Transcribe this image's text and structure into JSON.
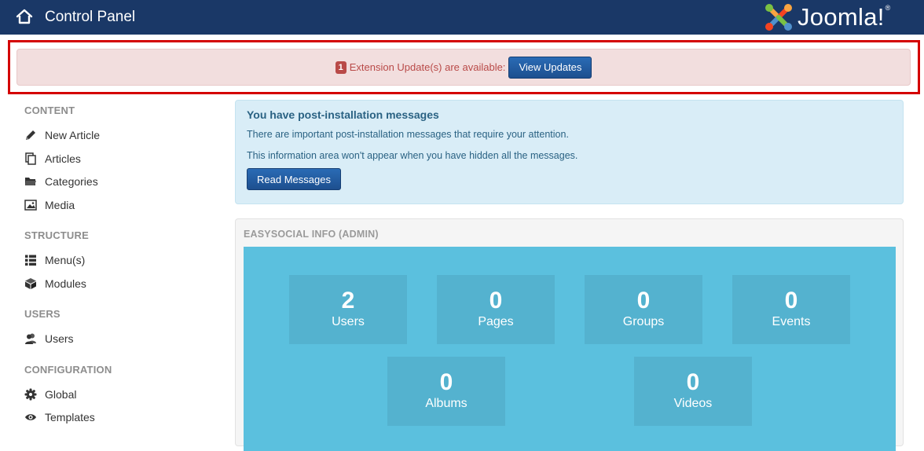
{
  "header": {
    "title": "Control Panel",
    "brand": "Joomla!",
    "home_icon": "home-icon",
    "colors": {
      "bar": "#1a3867"
    }
  },
  "alert": {
    "count": "1",
    "text": "Extension Update(s) are available:",
    "button": "View Updates",
    "colors": {
      "background": "#f2dede",
      "text": "#b94a48",
      "highlight": "#d40000"
    }
  },
  "sidebar": {
    "sections": [
      {
        "header": "CONTENT",
        "items": [
          {
            "label": "New Article",
            "icon": "pencil-icon"
          },
          {
            "label": "Articles",
            "icon": "copy-icon"
          },
          {
            "label": "Categories",
            "icon": "folder-icon"
          },
          {
            "label": "Media",
            "icon": "image-icon"
          }
        ]
      },
      {
        "header": "STRUCTURE",
        "items": [
          {
            "label": "Menu(s)",
            "icon": "list-icon"
          },
          {
            "label": "Modules",
            "icon": "cube-icon"
          }
        ]
      },
      {
        "header": "USERS",
        "items": [
          {
            "label": "Users",
            "icon": "users-icon"
          }
        ]
      },
      {
        "header": "CONFIGURATION",
        "items": [
          {
            "label": "Global",
            "icon": "gear-icon"
          },
          {
            "label": "Templates",
            "icon": "eye-icon"
          }
        ]
      }
    ]
  },
  "post_install": {
    "title": "You have post-installation messages",
    "text1": "There are important post-installation messages that require your attention.",
    "text2": "This information area won't appear when you have hidden all the messages.",
    "button": "Read Messages",
    "colors": {
      "background": "#d9edf7",
      "text": "#2a6283"
    }
  },
  "easysocial": {
    "title": "EASYSOCIAL INFO (ADMIN)",
    "colors": {
      "panel": "#5bc0de",
      "box": "#54b2cf"
    },
    "stats": [
      {
        "value": "2",
        "label": "Users"
      },
      {
        "value": "0",
        "label": "Pages"
      },
      {
        "value": "0",
        "label": "Groups"
      },
      {
        "value": "0",
        "label": "Events"
      },
      {
        "value": "0",
        "label": "Albums"
      },
      {
        "value": "0",
        "label": "Videos"
      }
    ]
  }
}
